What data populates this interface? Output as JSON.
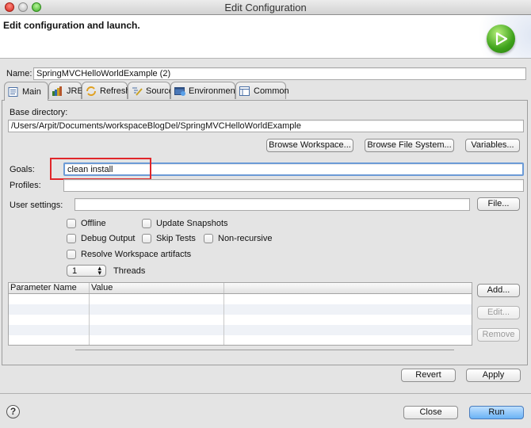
{
  "window": {
    "title": "Edit Configuration",
    "controls": [
      "close",
      "minimize",
      "zoom"
    ]
  },
  "header": {
    "title": "Edit configuration and launch.",
    "icon": "run-launch-icon"
  },
  "name": {
    "label": "Name:",
    "value": "SpringMVCHelloWorldExample (2)"
  },
  "tabs": [
    {
      "label": "Main",
      "icon": "main-tab-icon",
      "active": true
    },
    {
      "label": "JRE",
      "icon": "jre-icon",
      "active": false
    },
    {
      "label": "Refresh",
      "icon": "refresh-icon",
      "active": false
    },
    {
      "label": "Source",
      "icon": "source-icon",
      "active": false
    },
    {
      "label": "Environment",
      "icon": "environment-icon",
      "active": false
    },
    {
      "label": "Common",
      "icon": "common-icon",
      "active": false
    }
  ],
  "main": {
    "base_directory": {
      "label": "Base directory:",
      "value": "/Users/Arpit/Documents/workspaceBlogDel/SpringMVCHelloWorldExample"
    },
    "browse_workspace": "Browse Workspace...",
    "browse_file_system": "Browse File System...",
    "variables": "Variables...",
    "goals": {
      "label": "Goals:",
      "value": "clean install"
    },
    "profiles": {
      "label": "Profiles:",
      "value": ""
    },
    "user_settings": {
      "label": "User settings:",
      "value": "",
      "button": "File..."
    },
    "checkboxes": {
      "offline": {
        "label": "Offline",
        "checked": false
      },
      "update_snapshots": {
        "label": "Update Snapshots",
        "checked": false
      },
      "debug_output": {
        "label": "Debug Output",
        "checked": false
      },
      "skip_tests": {
        "label": "Skip Tests",
        "checked": false
      },
      "non_recursive": {
        "label": "Non-recursive",
        "checked": false
      },
      "resolve_workspace": {
        "label": "Resolve Workspace artifacts",
        "checked": false
      }
    },
    "threads": {
      "value": "1",
      "label": "Threads"
    },
    "parameters_table": {
      "columns": [
        "Parameter Name",
        "Value",
        ""
      ],
      "rows": []
    },
    "table_buttons": {
      "add": "Add...",
      "edit": "Edit...",
      "remove": "Remove"
    }
  },
  "footer": {
    "revert": "Revert",
    "apply": "Apply",
    "close": "Close",
    "run": "Run",
    "help_icon": "help-icon"
  },
  "colors": {
    "annotation_highlight": "#e0262a",
    "focus_ring": "#6c9bd6",
    "default_button": "#6ab2f5"
  }
}
